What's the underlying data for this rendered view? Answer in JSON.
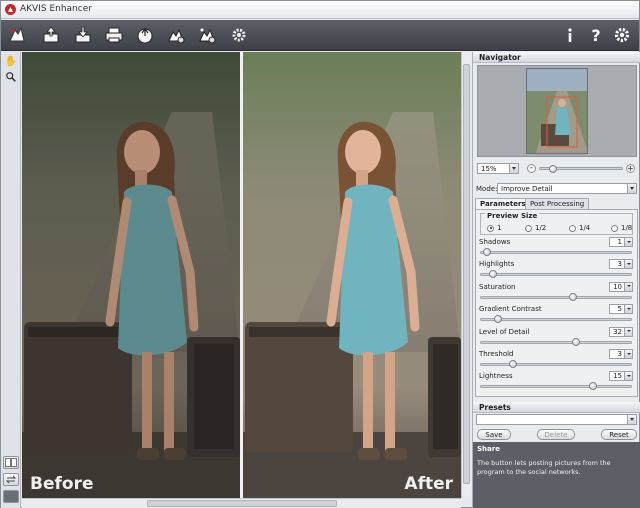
{
  "app": {
    "title": "AKVIS Enhancer",
    "brand_color": "#c8282b"
  },
  "toolbar": {
    "buttons": [
      {
        "name": "open-icon"
      },
      {
        "name": "save-icon"
      },
      {
        "name": "print-icon"
      },
      {
        "name": "share-icon"
      },
      {
        "name": "batch-settings-icon"
      },
      {
        "name": "plugin-settings-icon"
      },
      {
        "name": "preferences-gear-icon"
      }
    ],
    "right_buttons": [
      {
        "name": "info-icon"
      },
      {
        "name": "help-icon"
      },
      {
        "name": "settings-icon"
      }
    ]
  },
  "canvas": {
    "before_label": "Before",
    "after_label": "After"
  },
  "navigator": {
    "title": "Navigator",
    "zoom": "15%"
  },
  "mode": {
    "label": "Mode:",
    "value": "Improve Detail"
  },
  "tabs": [
    {
      "label": "Parameters",
      "active": true
    },
    {
      "label": "Post Processing",
      "active": false
    }
  ],
  "preview_size": {
    "title": "Preview Size",
    "options": [
      "1",
      "1/2",
      "1/4",
      "1/8"
    ],
    "selected": "1"
  },
  "parameters": [
    {
      "label": "Shadows",
      "value": "1",
      "fraction": 0.02
    },
    {
      "label": "Highlights",
      "value": "3",
      "fraction": 0.06
    },
    {
      "label": "Saturation",
      "value": "10",
      "fraction": 0.62
    },
    {
      "label": "Gradient Contrast",
      "value": "5",
      "fraction": 0.1
    },
    {
      "label": "Level of Detail",
      "value": "32",
      "fraction": 0.64
    },
    {
      "label": "Threshold",
      "value": "3",
      "fraction": 0.2
    },
    {
      "label": "Lightness",
      "value": "15",
      "fraction": 0.76
    }
  ],
  "presets": {
    "title": "Presets",
    "save": "Save",
    "delete": "Delete",
    "reset": "Reset"
  },
  "share": {
    "title": "Share",
    "description": "The button lets posting pictures from the program to the social networks."
  }
}
